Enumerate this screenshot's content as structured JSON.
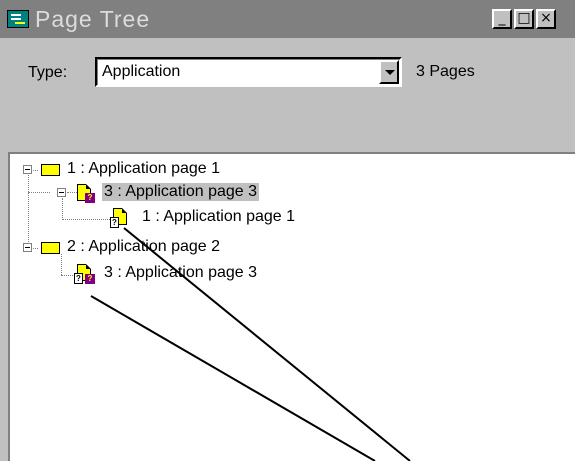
{
  "window": {
    "title": "Page Tree",
    "buttons": {
      "minimize": "_",
      "maximize": "□",
      "close": "×"
    }
  },
  "toolbar": {
    "type_label": "Type:",
    "type_value": "Application",
    "pages_count": "3 Pages"
  },
  "tree": {
    "nodes": [
      {
        "label": "1 : Application page 1",
        "icon": "folder-icon"
      },
      {
        "label": "3 : Application page 3",
        "icon": "page-missing-icon",
        "selected": true
      },
      {
        "label": "1 : Application page 1",
        "icon": "page-reference-icon"
      },
      {
        "label": "2 : Application page 2",
        "icon": "folder-icon"
      },
      {
        "label": "3 : Application page 3",
        "icon": "page-missing-reference-icon"
      }
    ]
  }
}
